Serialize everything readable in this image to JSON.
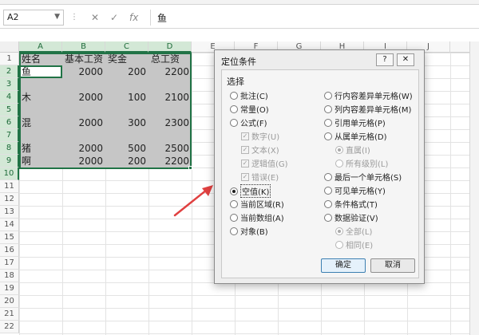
{
  "formula_bar": {
    "name_box": "A2",
    "cancel_glyph": "✕",
    "enter_glyph": "✓",
    "fx_glyph": "fx",
    "content": "鱼"
  },
  "columns": [
    "A",
    "B",
    "C",
    "D",
    "E",
    "F",
    "G",
    "H",
    "I",
    "J"
  ],
  "rows": [
    "1",
    "2",
    "3",
    "4",
    "5",
    "6",
    "7",
    "8",
    "9",
    "10",
    "11",
    "12",
    "13",
    "14",
    "15",
    "16",
    "17",
    "18",
    "19",
    "20",
    "21",
    "22"
  ],
  "headers": {
    "name": "姓名",
    "base": "基本工资",
    "bonus": "奖金",
    "total": "总工资"
  },
  "data_rows": [
    {
      "name": "鱼",
      "base": "2000",
      "bonus": "200",
      "total": "2200"
    },
    {
      "name": "木",
      "base": "2000",
      "bonus": "100",
      "total": "2100"
    },
    {
      "name": "混",
      "base": "2000",
      "bonus": "300",
      "total": "2300"
    },
    {
      "name": "猪",
      "base": "2000",
      "bonus": "500",
      "total": "2500"
    },
    {
      "name": "啊",
      "base": "2000",
      "bonus": "200",
      "total": "2200"
    }
  ],
  "dialog": {
    "title": "定位条件",
    "help": "?",
    "close": "✕",
    "section": "选择",
    "left_options": {
      "comments": "批注(C)",
      "constants": "常量(O)",
      "formulas": "公式(F)",
      "numbers": "数字(U)",
      "text": "文本(X)",
      "logicals": "逻辑值(G)",
      "errors": "错误(E)",
      "blanks": "空值(K)",
      "current_region": "当前区域(R)",
      "current_array": "当前数组(A)",
      "objects": "对象(B)"
    },
    "right_options": {
      "row_diff": "行内容差异单元格(W)",
      "col_diff": "列内容差异单元格(M)",
      "precedents": "引用单元格(P)",
      "dependents": "从属单元格(D)",
      "direct": "直属(I)",
      "all_levels": "所有级别(L)",
      "last_cell": "最后一个单元格(S)",
      "visible": "可见单元格(Y)",
      "conditional": "条件格式(T)",
      "validation": "数据验证(V)",
      "all": "全部(L)",
      "same": "相同(E)"
    },
    "ok": "确定",
    "cancel": "取消"
  },
  "colors": {
    "selection_border": "#217346",
    "selection_fill": "#c6c6c6",
    "arrow": "#e04040"
  }
}
